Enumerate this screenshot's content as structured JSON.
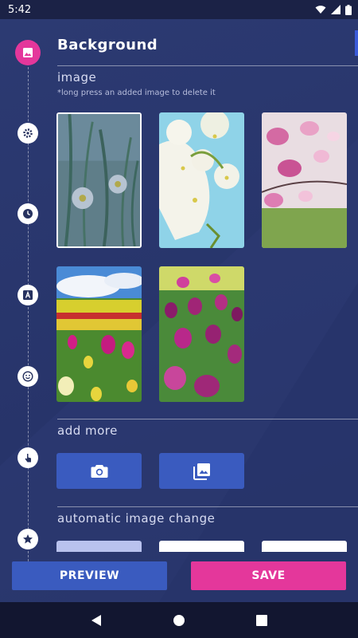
{
  "status_bar": {
    "time": "5:42",
    "icons": [
      "wifi-icon",
      "signal-icon",
      "battery-icon"
    ]
  },
  "timeline": {
    "icons": [
      "image-icon",
      "gear-icon",
      "clock-icon",
      "text-icon",
      "emoji-icon",
      "touch-icon",
      "star-icon"
    ],
    "active": "image-icon"
  },
  "section": {
    "title": "Background"
  },
  "image_section": {
    "label": "image",
    "hint": "*long press an added image to delete it",
    "images": [
      {
        "name": "daisies-grass",
        "selected": true
      },
      {
        "name": "white-blossoms",
        "selected": false
      },
      {
        "name": "pink-magnolia",
        "selected": false
      },
      {
        "name": "tulip-field-yellow",
        "selected": false
      },
      {
        "name": "tulips-purple",
        "selected": false
      }
    ]
  },
  "add_more": {
    "label": "add more",
    "buttons": [
      "camera-icon",
      "gallery-icon"
    ]
  },
  "auto_change": {
    "label": "automatic image change"
  },
  "actions": {
    "preview": "PREVIEW",
    "save": "SAVE"
  },
  "colors": {
    "accent_pink": "#e4379b",
    "accent_blue": "#3a5bbf",
    "background": "#27325f"
  }
}
